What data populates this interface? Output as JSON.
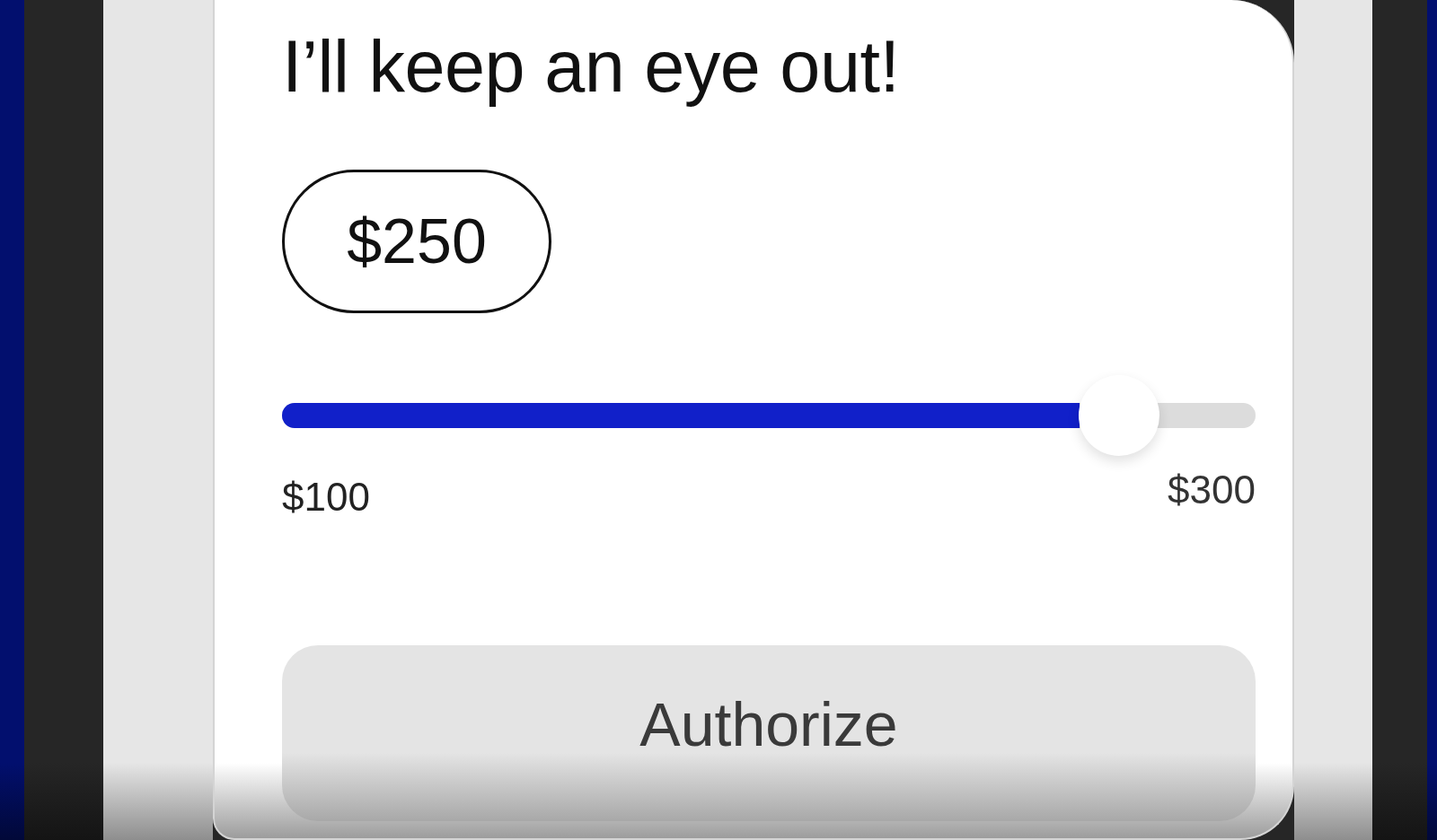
{
  "title": "I’ll keep an eye out!",
  "amount": {
    "value": "$250"
  },
  "slider": {
    "level": 0.86,
    "min_label": "$100",
    "max_label": "$300"
  },
  "buttons": [
    {
      "label": "Authorize"
    }
  ]
}
